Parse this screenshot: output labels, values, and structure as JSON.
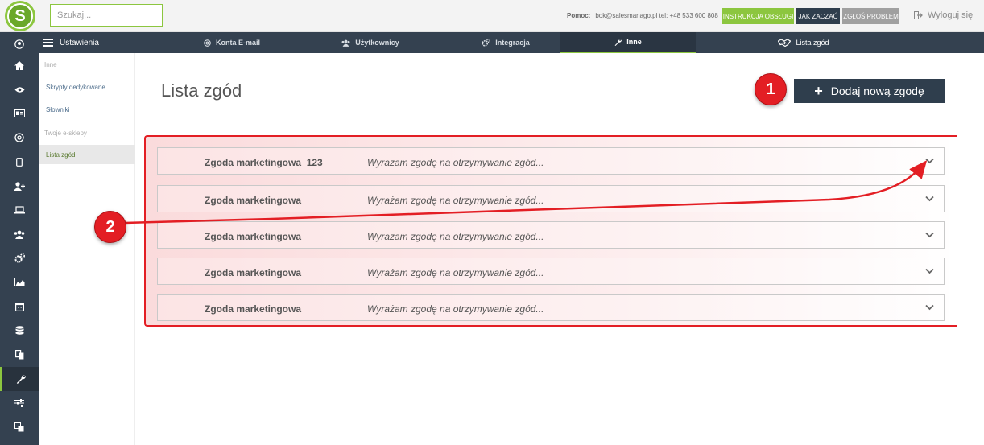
{
  "topbar": {
    "search_placeholder": "Szukaj...",
    "help_label": "Pomoc:",
    "help_contact": "bok@salesmanago.pl tel: +48 533 600 808",
    "btn_instruction": "INSTRUKCJA OBSŁUGI",
    "btn_start": "JAK ZACZĄĆ",
    "btn_report": "ZGŁOŚ PROBLEM",
    "logout": "Wyloguj się",
    "colors": {
      "green": "#8cc63f",
      "navy": "#2f3e4d",
      "gray": "#a0a0a0"
    }
  },
  "nav": {
    "settings": "Ustawienia",
    "tabs": [
      {
        "label": "Konta E-mail",
        "icon": "at-icon"
      },
      {
        "label": "Użytkownicy",
        "icon": "users-icon"
      },
      {
        "label": "Integracja",
        "icon": "cogs-icon"
      },
      {
        "label": "Inne",
        "icon": "wrench-icon"
      },
      {
        "label": "Lista zgód",
        "icon": "handshake-icon"
      }
    ]
  },
  "submenu": {
    "head1": "Inne",
    "item1": "Skrypty dedykowane",
    "item2": "Słowniki",
    "head2": "Twoje e-sklepy",
    "item3": "Lista zgód"
  },
  "main": {
    "title": "Lista zgód",
    "add_button": "Dodaj nową zgodę",
    "consents": [
      {
        "name": "Zgoda marketingowa_123",
        "desc": "Wyrażam zgodę na otrzymywanie zgód..."
      },
      {
        "name": "Zgoda marketingowa",
        "desc": "Wyrażam zgodę na otrzymywanie zgód..."
      },
      {
        "name": "Zgoda marketingowa",
        "desc": "Wyrażam zgodę na otrzymywanie zgód..."
      },
      {
        "name": "Zgoda marketingowa",
        "desc": "Wyrażam zgodę na otrzymywanie zgód..."
      },
      {
        "name": "Zgoda marketingowa",
        "desc": "Wyrażam zgodę na otrzymywanie zgód..."
      }
    ]
  },
  "annotations": {
    "marker1": "1",
    "marker2": "2",
    "accent": "#e31e24"
  }
}
